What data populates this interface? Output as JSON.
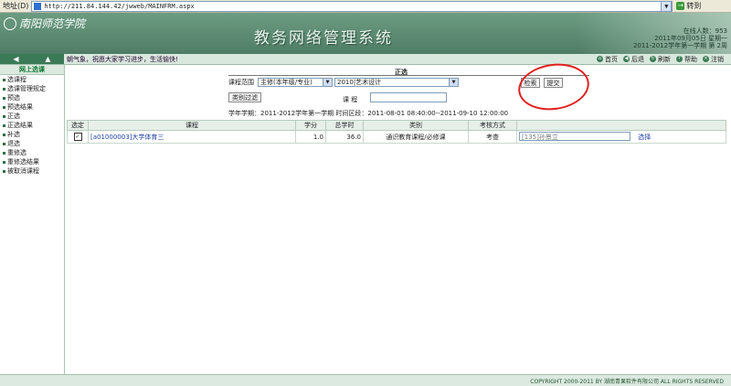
{
  "browser": {
    "address_label": "地址(D)",
    "url": "http://211.84.144.42/jwweb/MAINFRM.aspx",
    "go_label": "转到"
  },
  "banner": {
    "school_name": "南阳师范学院",
    "system_title": "教务网络管理系统",
    "online_count": "在线人数：953",
    "date": "2011年09月05日 星期一",
    "term_week": "2011-2012学年第一学期 第 2周"
  },
  "toolbar": {
    "motto": "朝气象，祝愿大家学习进步，生活愉快!",
    "items": [
      "首页",
      "后退",
      "刷新",
      "帮助",
      "注销"
    ]
  },
  "sidebar": {
    "header": "网上选课",
    "items": [
      "选课程",
      "选课管理规定",
      "预选",
      "预选结果",
      "正选",
      "正选结果",
      "补选",
      "退选",
      "重修选",
      "重修选结果",
      "被取消课程"
    ]
  },
  "form": {
    "title": "正选",
    "scope_label": "课程范围",
    "scope_value": "主修(本年级/专业)",
    "major_value": "2010|艺术设计",
    "search_button": "检索",
    "submit_button": "提交",
    "filter_button": "类别过滤",
    "course_label": "课    程",
    "course_value": "",
    "term_info": "学年学期：2011-2012学年第一学期   时间区段：2011-08-01 08:40:00--2011-09-10 12:00:00"
  },
  "table": {
    "headers": [
      "选定",
      "课程",
      "学分",
      "总学时",
      "类别",
      "考核方式",
      ""
    ],
    "rows": [
      {
        "selected": "✓",
        "course": "[a01000003]大学体育三",
        "credit": "1.0",
        "hours": "36.0",
        "category": "通识教育课程/必修课",
        "exam": "考查",
        "teacher": "[135]孙景立",
        "action": "选择"
      }
    ]
  },
  "footer": {
    "copyright": "COPYRIGHT 2000-2011 BY 湖南青果软件有限公司 ALL RIGHTS RESERVED"
  },
  "colors": {
    "banner": "#5f8f75",
    "accent": "#3b7a56",
    "annotation_circle": "#e02020"
  }
}
